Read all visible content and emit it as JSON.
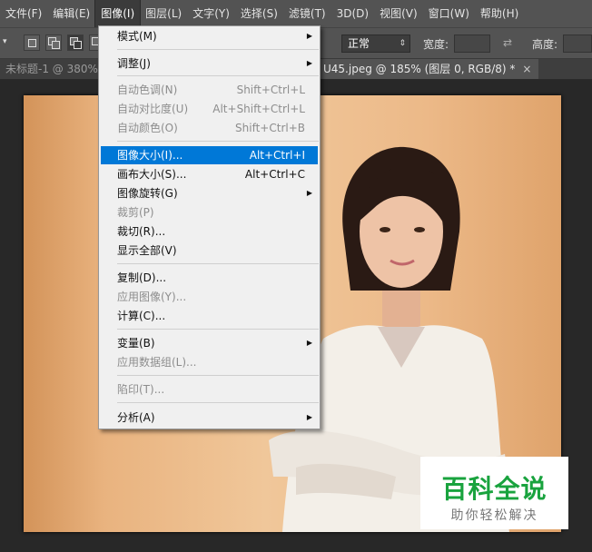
{
  "menubar": {
    "items": [
      "文件(F)",
      "编辑(E)",
      "图像(I)",
      "图层(L)",
      "文字(Y)",
      "选择(S)",
      "滤镜(T)",
      "3D(D)",
      "视图(V)",
      "窗口(W)",
      "帮助(H)"
    ]
  },
  "optionsbar": {
    "blend_mode": "正常",
    "width_label": "宽度:",
    "height_label": "高度:"
  },
  "tabs": {
    "inactive": "未标题-1 @ 380%",
    "active": "U45.jpeg @ 185% (图层 0, RGB/8) *",
    "close": "×"
  },
  "image_menu": {
    "mode": {
      "label": "模式(M)"
    },
    "adjust": {
      "label": "调整(J)"
    },
    "auto_tone": {
      "label": "自动色调(N)",
      "shortcut": "Shift+Ctrl+L"
    },
    "auto_contrast": {
      "label": "自动对比度(U)",
      "shortcut": "Alt+Shift+Ctrl+L"
    },
    "auto_color": {
      "label": "自动颜色(O)",
      "shortcut": "Shift+Ctrl+B"
    },
    "image_size": {
      "label": "图像大小(I)...",
      "shortcut": "Alt+Ctrl+I"
    },
    "canvas_size": {
      "label": "画布大小(S)...",
      "shortcut": "Alt+Ctrl+C"
    },
    "rotation": {
      "label": "图像旋转(G)"
    },
    "crop": {
      "label": "裁剪(P)"
    },
    "trim": {
      "label": "裁切(R)..."
    },
    "reveal_all": {
      "label": "显示全部(V)"
    },
    "duplicate": {
      "label": "复制(D)..."
    },
    "apply_image": {
      "label": "应用图像(Y)..."
    },
    "calculations": {
      "label": "计算(C)..."
    },
    "variables": {
      "label": "变量(B)"
    },
    "apply_dataset": {
      "label": "应用数据组(L)..."
    },
    "trap": {
      "label": "陷印(T)..."
    },
    "analysis": {
      "label": "分析(A)"
    }
  },
  "watermark": {
    "title": "百科全说",
    "subtitle": "助你轻松解决"
  },
  "colors": {
    "highlight": "#0078d7",
    "watermark_green": "#19a33e",
    "menubar_bg": "#535353"
  }
}
